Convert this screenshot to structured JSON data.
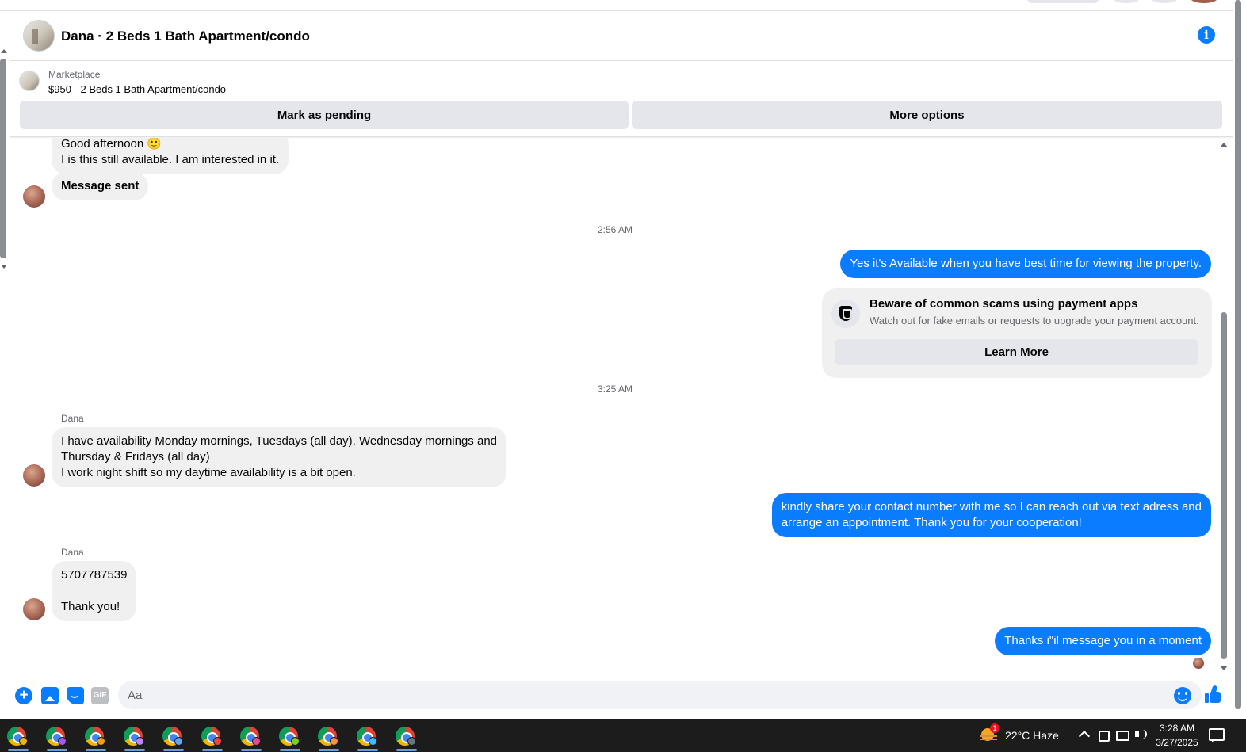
{
  "conversation": {
    "title": "Dana · 2 Beds 1 Bath Apartment/condo"
  },
  "listing": {
    "source": "Marketplace",
    "price_title": "$950 - 2 Beds 1 Bath Apartment/condo",
    "mark_pending_label": "Mark as pending",
    "more_options_label": "More options"
  },
  "messages": {
    "first_incoming": "Good afternoon 🙂\nI is this still available. I am interested in it.",
    "message_sent": "Message sent",
    "time_1": "2:56 AM",
    "reply_1": "Yes it's Available when you have best time for viewing the property.",
    "scam_card": {
      "title": "Beware of common scams using payment apps",
      "body": "Watch out for fake emails or requests to upgrade your payment account.",
      "button": "Learn More"
    },
    "time_2": "3:25 AM",
    "sender_1": "Dana",
    "incoming_availability": "I have availability Monday mornings, Tuesdays (all day), Wednesday mornings and\nThursday & Fridays (all day)\nI work night shift so my daytime availability is a bit open.",
    "reply_2": "kindly share your contact number with me so I can reach out via text adress and\narrange an appointment. Thank you for your cooperation!",
    "sender_2": "Dana",
    "incoming_number": "5707787539\n\nThank you!",
    "reply_3": "Thanks i\"il message you in a moment"
  },
  "composer": {
    "placeholder": "Aa",
    "gif_label": "GIF"
  },
  "taskbar": {
    "apps": [
      {
        "icon": "chrome-icon",
        "profile_color": "#f4b400"
      },
      {
        "icon": "chrome-icon",
        "profile_color": "#a855f7"
      },
      {
        "icon": "chrome-icon",
        "profile_color": "#f59e0b"
      },
      {
        "icon": "chrome-icon",
        "profile_color": "#c084fc"
      },
      {
        "icon": "chrome-icon",
        "profile_color": "#60a5fa"
      },
      {
        "icon": "chrome-icon",
        "profile_color": "#ef4444"
      },
      {
        "icon": "chrome-icon",
        "profile_color": "#ec4899"
      },
      {
        "icon": "chrome-icon",
        "profile_color": "#84cc16"
      },
      {
        "icon": "chrome-icon",
        "profile_color": "#fb923c"
      },
      {
        "icon": "chrome-icon",
        "profile_color": "#38bdf8"
      },
      {
        "icon": "chrome-icon",
        "profile_color": "#6b7280"
      }
    ],
    "weather_badge": "1",
    "weather_text": "22°C  Haze",
    "time": "3:28 AM",
    "date": "3/27/2025"
  },
  "colors": {
    "accent_blue": "#0a7cff",
    "incoming_bubble": "#f0f0f0",
    "taskbar": "#1c1c1c"
  }
}
